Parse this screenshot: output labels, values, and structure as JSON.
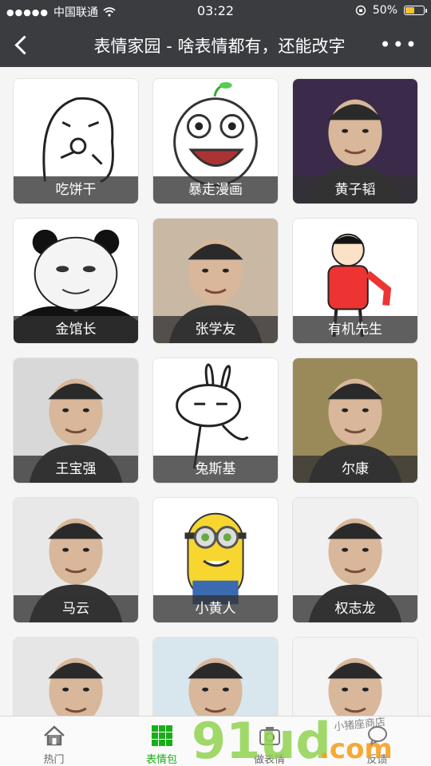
{
  "status": {
    "carrier": "中国联通",
    "time": "03:22",
    "battery_text": "50%",
    "battery_level": 0.5
  },
  "nav": {
    "title": "表情家园 - 啥表情都有，还能改字"
  },
  "cards": [
    {
      "label": "吃饼干",
      "bg": "#ffffff",
      "art": "doodle"
    },
    {
      "label": "暴走漫画",
      "bg": "#ffffff",
      "art": "rage"
    },
    {
      "label": "黄子韬",
      "bg": "#3b2a4a",
      "art": "photo"
    },
    {
      "label": "金馆长",
      "bg": "#ffffff",
      "art": "panda"
    },
    {
      "label": "张学友",
      "bg": "#c9b8a4",
      "art": "photo"
    },
    {
      "label": "有机先生",
      "bg": "#ffffff",
      "art": "redman"
    },
    {
      "label": "王宝强",
      "bg": "#d8d8d8",
      "art": "photo"
    },
    {
      "label": "兔斯基",
      "bg": "#ffffff",
      "art": "rabbit"
    },
    {
      "label": "尔康",
      "bg": "#9a8a5a",
      "art": "photo"
    },
    {
      "label": "马云",
      "bg": "#e8e8e8",
      "art": "photo"
    },
    {
      "label": "小黄人",
      "bg": "#ffffff",
      "art": "minion"
    },
    {
      "label": "权志龙",
      "bg": "#f0f0f0",
      "art": "photo"
    },
    {
      "label": "",
      "bg": "#e6e6e6",
      "art": "photo"
    },
    {
      "label": "",
      "bg": "#d8e6ee",
      "art": "photo"
    },
    {
      "label": "",
      "bg": "#f4f4f4",
      "art": "photo"
    }
  ],
  "tabs": [
    {
      "label": "热门",
      "icon": "home-icon"
    },
    {
      "label": "表情包",
      "icon": "grid-icon",
      "active": true
    },
    {
      "label": "做表情",
      "icon": "camera-icon"
    },
    {
      "label": "反馈",
      "icon": "feedback-icon"
    }
  ],
  "watermark": {
    "brand": "91ud",
    "domain": ".com",
    "slogan": "小猪座商店"
  },
  "colors": {
    "bar_bg": "#3a3c40",
    "active_green": "#1aad19",
    "battery_yellow": "#f4c430"
  }
}
